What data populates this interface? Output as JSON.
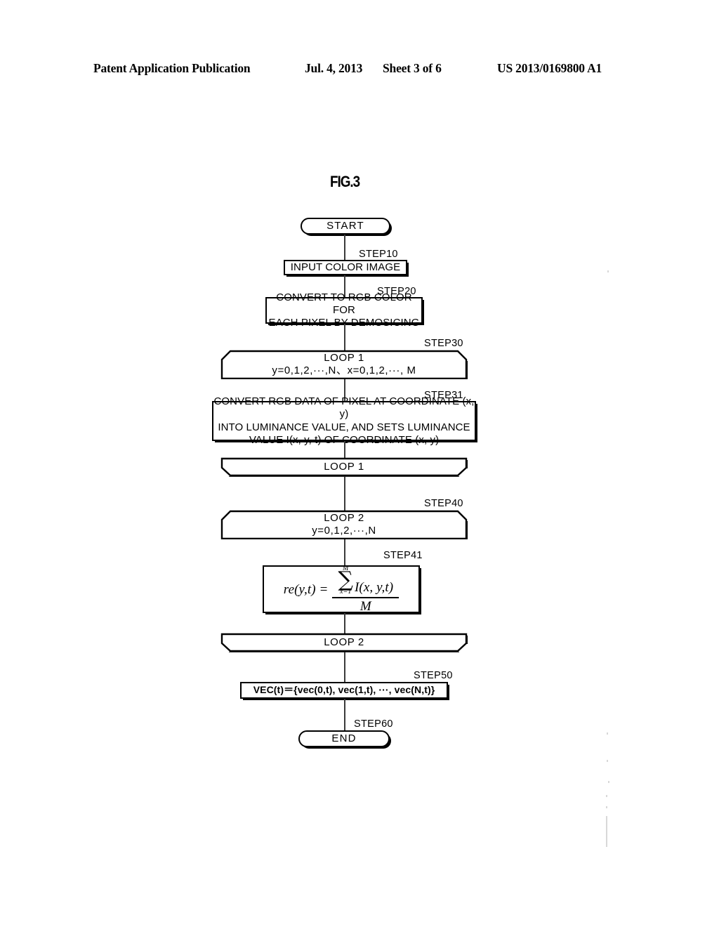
{
  "header": {
    "publication": "Patent Application Publication",
    "date": "Jul. 4, 2013",
    "sheet": "Sheet 3 of 6",
    "patent_number": "US 2013/0169800 A1"
  },
  "figure": {
    "title": "FIG.3"
  },
  "flowchart": {
    "nodes": {
      "start": {
        "label": "START",
        "step": ""
      },
      "step10": {
        "label": "INPUT COLOR IMAGE",
        "step": "STEP10"
      },
      "step20": {
        "line1": "CONVERT TO RGB COLOR FOR",
        "line2": "EACH PIXEL BY DEMOSICING",
        "step": "STEP20"
      },
      "loop1_begin": {
        "line1": "LOOP 1",
        "line2": "y=0,1,2,···,N、x=0,1,2,···, M",
        "step": "STEP30"
      },
      "step31": {
        "line1": "CONVERT RGB DATA OF PIXEL AT COORDINATE (x, y)",
        "line2": "INTO LUMINANCE VALUE, AND SETS LUMINANCE",
        "line3": "VALUE I(x, y, t) OF COORDINATE (x, y)",
        "step": "STEP31"
      },
      "loop1_end": {
        "label": "LOOP 1",
        "step": ""
      },
      "loop2_begin": {
        "line1": "LOOP 2",
        "line2": "y=0,1,2,···,N",
        "step": "STEP40"
      },
      "step41": {
        "step": "STEP41",
        "lhs": "re(y,t) =",
        "sum_upper": "M",
        "sum_symbol": "∑",
        "sum_lower": "x=1",
        "sum_argument": "I(x, y,t)",
        "denominator": "M"
      },
      "loop2_end": {
        "label": "LOOP 2",
        "step": ""
      },
      "step50": {
        "label": "VEC(t)＝{vec(0,t), vec(1,t), ···, vec(N,t)}",
        "step": "STEP50"
      },
      "end": {
        "label": "END",
        "step": "STEP60"
      }
    }
  }
}
